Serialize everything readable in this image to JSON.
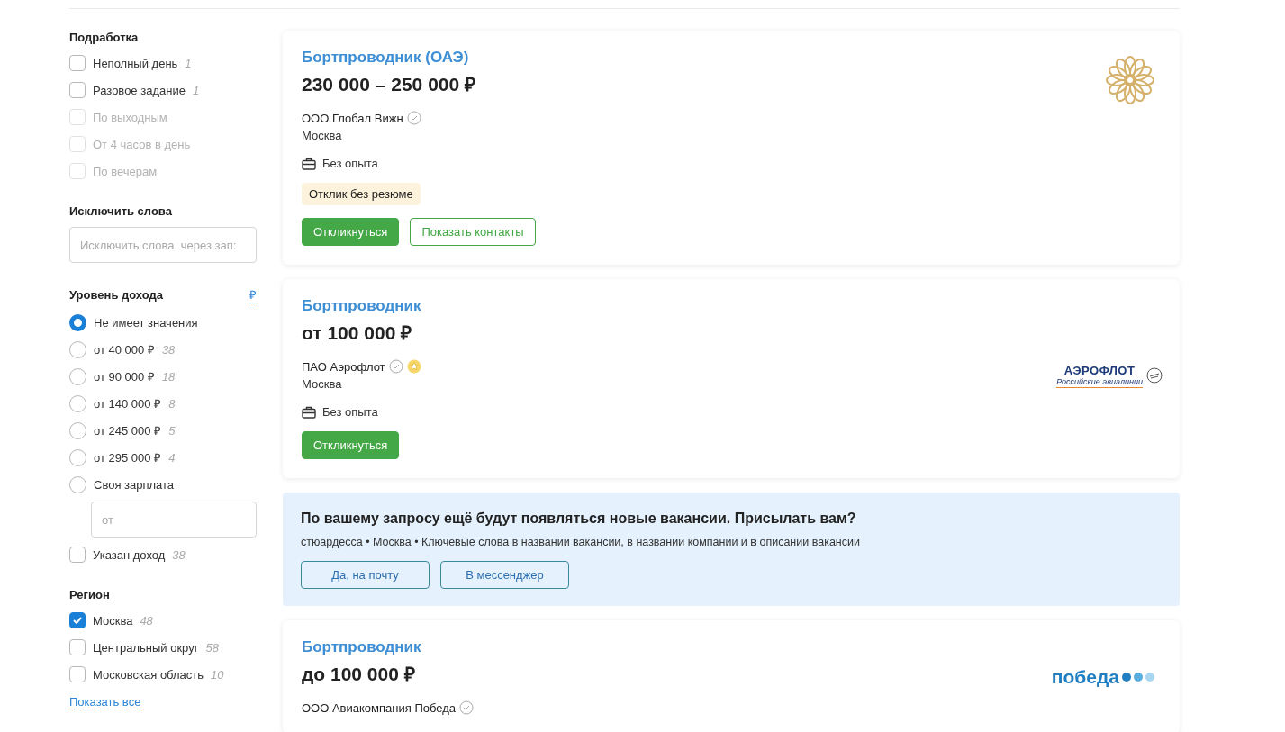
{
  "sidebar": {
    "sections": [
      {
        "kind": "checklist",
        "title": "Подработка",
        "items": [
          {
            "label": "Неполный день",
            "count": "1",
            "checked": false,
            "disabled": false
          },
          {
            "label": "Разовое задание",
            "count": "1",
            "checked": false,
            "disabled": false
          },
          {
            "label": "По выходным",
            "checked": false,
            "disabled": true
          },
          {
            "label": "От 4 часов в день",
            "checked": false,
            "disabled": true
          },
          {
            "label": "По вечерам",
            "checked": false,
            "disabled": true
          }
        ]
      },
      {
        "kind": "input",
        "title": "Исключить слова",
        "placeholder": "Исключить слова, через зап:"
      },
      {
        "kind": "income",
        "title": "Уровень дохода",
        "currency": "₽",
        "options": [
          {
            "label": "Не имеет значения",
            "selected": true
          },
          {
            "label": "от 40 000 ₽",
            "count": "38",
            "selected": false
          },
          {
            "label": "от 90 000 ₽",
            "count": "18",
            "selected": false
          },
          {
            "label": "от 140 000 ₽",
            "count": "8",
            "selected": false
          },
          {
            "label": "от 245 000 ₽",
            "count": "5",
            "selected": false
          },
          {
            "label": "от 295 000 ₽",
            "count": "4",
            "selected": false
          },
          {
            "label": "Своя зарплата",
            "selected": false
          }
        ],
        "custom_placeholder": "от",
        "extra": {
          "label": "Указан доход",
          "count": "38",
          "checked": false,
          "disabled": false
        }
      },
      {
        "kind": "checklist",
        "title": "Регион",
        "items": [
          {
            "label": "Москва",
            "count": "48",
            "checked": true,
            "disabled": false
          },
          {
            "label": "Центральный округ",
            "count": "58",
            "checked": false,
            "disabled": false
          },
          {
            "label": "Московская область",
            "count": "10",
            "checked": false,
            "disabled": false
          }
        ],
        "link": "Показать все"
      }
    ]
  },
  "results": [
    {
      "kind": "vacancy",
      "title": "Бортпроводник (ОАЭ)",
      "salary": "230 000 – 250 000 ₽",
      "company": "ООО Глобал Вижн",
      "verified": true,
      "award": false,
      "city": "Москва",
      "experience": "Без опыта",
      "tag": "Отклик без резюме",
      "logo": {
        "kind": "emblem"
      },
      "buttons": [
        {
          "kind": "primary",
          "label": "Откликнуться"
        },
        {
          "kind": "outline",
          "label": "Показать контакты"
        }
      ]
    },
    {
      "kind": "vacancy",
      "title": "Бортпроводник",
      "salary": "от 100 000 ₽",
      "company": "ПАО Аэрофлот",
      "verified": true,
      "award": true,
      "city": "Москва",
      "experience": "Без опыта",
      "logo": {
        "kind": "aeroflot",
        "text": "АЭРОФЛОТ",
        "subtitle": "Российские авиалинии"
      },
      "buttons": [
        {
          "kind": "primary",
          "label": "Откликнуться"
        }
      ]
    },
    {
      "kind": "subscribe",
      "title": "По вашему запросу ещё будут появляться новые вакансии. Присылать вам?",
      "query": "стюардесса • Москва • Ключевые слова в названии вакансии, в названии компании и в описании вакансии",
      "buttons": [
        {
          "kind": "blue",
          "label": "Да, на почту"
        },
        {
          "kind": "blue",
          "label": "В мессенджер"
        }
      ]
    },
    {
      "kind": "vacancy",
      "title": "Бортпроводник",
      "salary": "до 100 000 ₽",
      "company": "ООО Авиакомпания Победа",
      "verified": true,
      "award": false,
      "logo": {
        "kind": "pobeda",
        "text": "победа"
      }
    }
  ]
}
